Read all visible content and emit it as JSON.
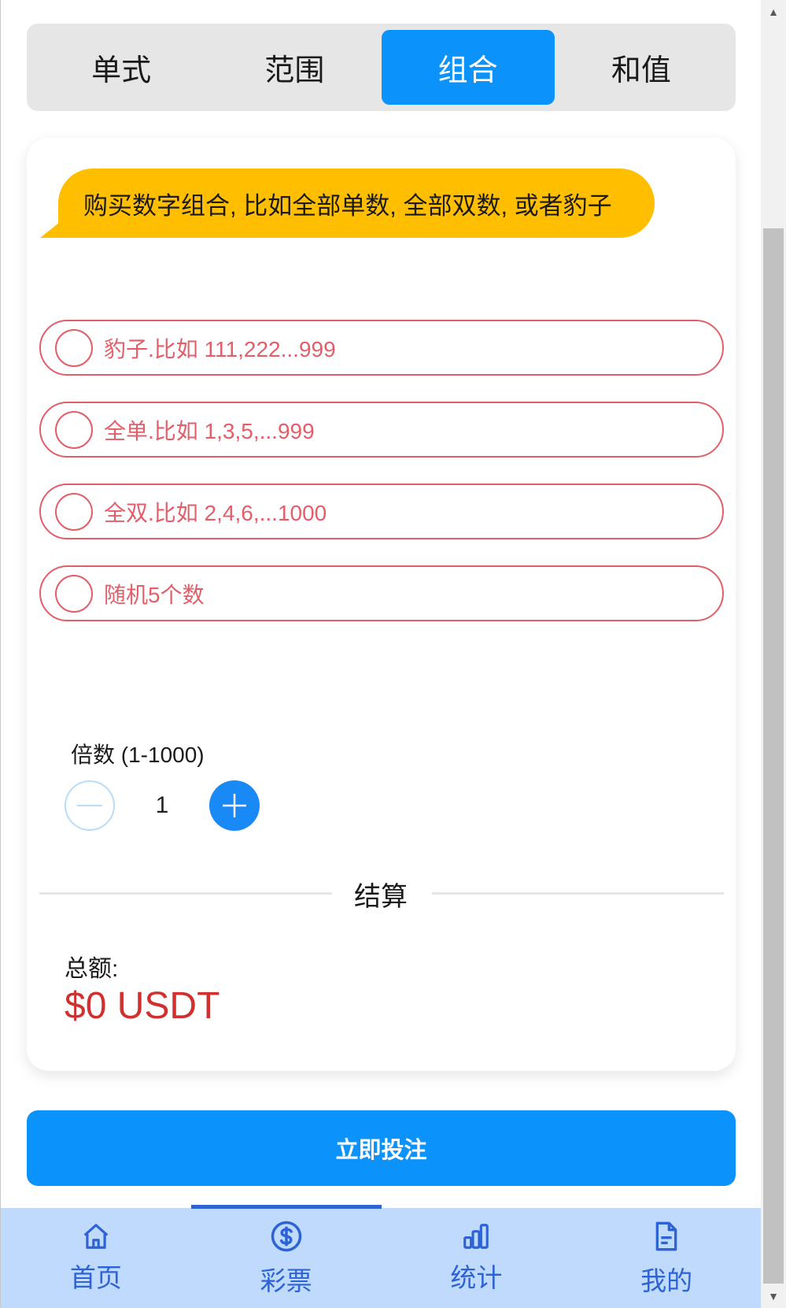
{
  "tabs": [
    {
      "label": "单式",
      "active": false
    },
    {
      "label": "范围",
      "active": false
    },
    {
      "label": "组合",
      "active": true
    },
    {
      "label": "和值",
      "active": false
    }
  ],
  "bubble": {
    "text": "购买数字组合, 比如全部单数, 全部双数, 或者豹子"
  },
  "options": [
    {
      "label": "豹子.比如 111,222...999"
    },
    {
      "label": "全单.比如 1,3,5,...999"
    },
    {
      "label": "全双.比如 2,4,6,...1000"
    },
    {
      "label": "随机5个数"
    }
  ],
  "multiplier": {
    "label": "倍数 (1-1000)",
    "value": "1"
  },
  "settlement": {
    "divider_label": "结算",
    "total_label": "总额:",
    "total_value": "$0 USDT"
  },
  "submit": {
    "label": "立即投注"
  },
  "nav": [
    {
      "label": "首页",
      "icon": "home-icon",
      "active": false
    },
    {
      "label": "彩票",
      "icon": "dollar-circle-icon",
      "active": true
    },
    {
      "label": "统计",
      "icon": "bar-chart-icon",
      "active": false
    },
    {
      "label": "我的",
      "icon": "document-icon",
      "active": false
    }
  ],
  "colors": {
    "accent": "#0b93fb",
    "bubble": "#ffbf00",
    "option_border": "#e35e68",
    "total": "#d22f2f",
    "nav_bg": "#bfdafc",
    "nav_fg": "#2d63d4"
  }
}
